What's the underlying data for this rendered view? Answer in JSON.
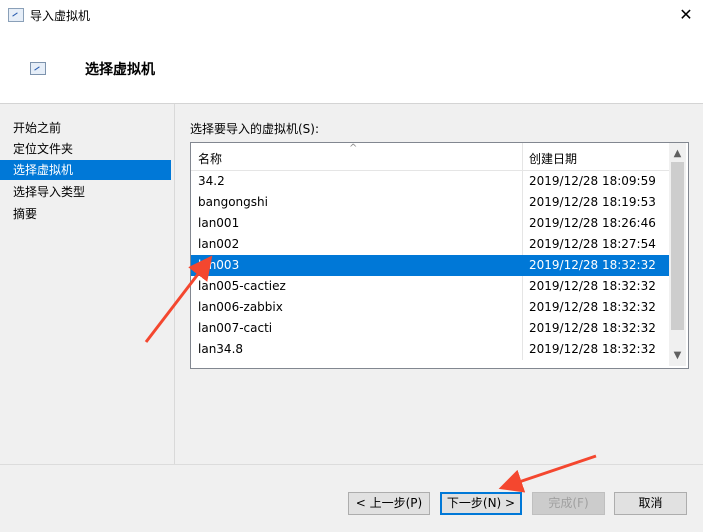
{
  "window": {
    "title": "导入虚拟机",
    "close_glyph": "✕"
  },
  "header": {
    "title": "选择虚拟机",
    "icon": "import-vm-icon"
  },
  "nav": {
    "items": [
      {
        "label": "开始之前",
        "active": false
      },
      {
        "label": "定位文件夹",
        "active": false
      },
      {
        "label": "选择虚拟机",
        "active": true
      },
      {
        "label": "选择导入类型",
        "active": false
      },
      {
        "label": "摘要",
        "active": false
      }
    ]
  },
  "content": {
    "list_label": "选择要导入的虚拟机(S):",
    "columns": {
      "name": "名称",
      "date": "创建日期",
      "sort_glyph": "^"
    },
    "rows": [
      {
        "name": "34.2",
        "date": "2019/12/28 18:09:59",
        "selected": false
      },
      {
        "name": "bangongshi",
        "date": "2019/12/28 18:19:53",
        "selected": false
      },
      {
        "name": "lan001",
        "date": "2019/12/28 18:26:46",
        "selected": false
      },
      {
        "name": "lan002",
        "date": "2019/12/28 18:27:54",
        "selected": false
      },
      {
        "name": "lan003",
        "date": "2019/12/28 18:32:32",
        "selected": true
      },
      {
        "name": "lan005-cactiez",
        "date": "2019/12/28 18:32:32",
        "selected": false
      },
      {
        "name": "lan006-zabbix",
        "date": "2019/12/28 18:32:32",
        "selected": false
      },
      {
        "name": "lan007-cacti",
        "date": "2019/12/28 18:32:32",
        "selected": false
      },
      {
        "name": "lan34.8",
        "date": "2019/12/28 18:32:32",
        "selected": false
      }
    ],
    "scroll_up_glyph": "▲",
    "scroll_down_glyph": "▼"
  },
  "footer": {
    "prev": "< 上一步(P)",
    "next": "下一步(N) >",
    "finish": "完成(F)",
    "cancel": "取消"
  },
  "colors": {
    "accent": "#0078d7",
    "annotation": "#f4472f"
  }
}
